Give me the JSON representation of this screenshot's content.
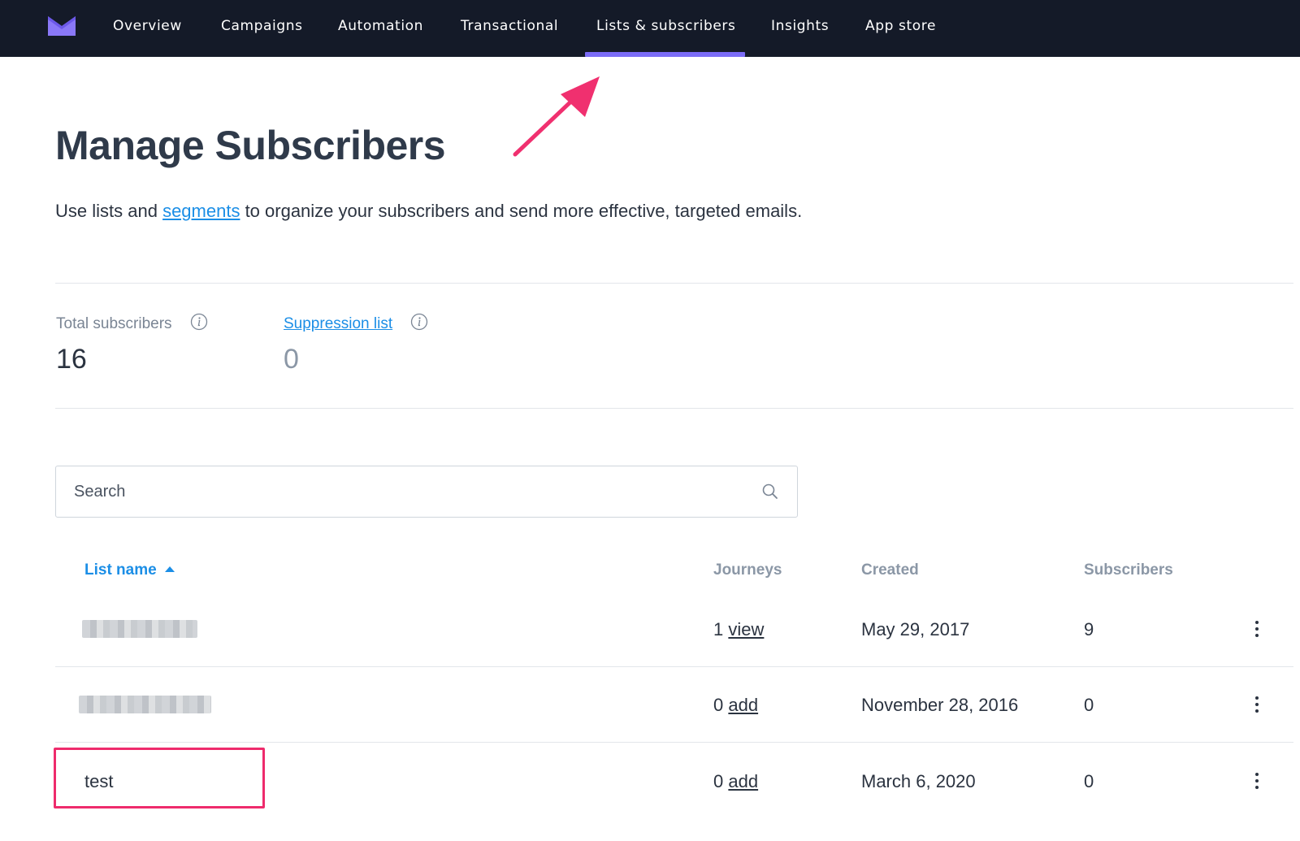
{
  "nav": {
    "items": [
      {
        "label": "Overview"
      },
      {
        "label": "Campaigns"
      },
      {
        "label": "Automation"
      },
      {
        "label": "Transactional"
      },
      {
        "label": "Lists & subscribers",
        "active": true
      },
      {
        "label": "Insights"
      },
      {
        "label": "App store"
      }
    ],
    "accent_color": "#7b6cf6",
    "logo_icon": "mailchimp-envelope-logo"
  },
  "page": {
    "title": "Manage Subscribers",
    "intro_before": "Use lists and ",
    "intro_link": "segments",
    "intro_after": " to organize your subscribers and send more effective, targeted emails."
  },
  "stats": {
    "total_label": "Total subscribers",
    "total_value": "16",
    "suppression_label": "Suppression list",
    "suppression_value": "0"
  },
  "search": {
    "placeholder": "Search",
    "icon": "search-icon"
  },
  "table": {
    "headers": {
      "list_name": "List name",
      "journeys": "Journeys",
      "created": "Created",
      "subscribers": "Subscribers"
    },
    "rows": [
      {
        "name": "",
        "name_blurred": true,
        "journeys_count": "1",
        "journeys_action": "view",
        "created": "May 29, 2017",
        "subscribers": "9"
      },
      {
        "name": "",
        "name_blurred": true,
        "journeys_count": "0",
        "journeys_action": "add",
        "created": "November 28, 2016",
        "subscribers": "0"
      },
      {
        "name": "test",
        "name_blurred": false,
        "journeys_count": "0",
        "journeys_action": "add",
        "created": "March 6, 2020",
        "subscribers": "0"
      }
    ]
  },
  "annotation": {
    "highlight_color": "#ee2b6c"
  }
}
